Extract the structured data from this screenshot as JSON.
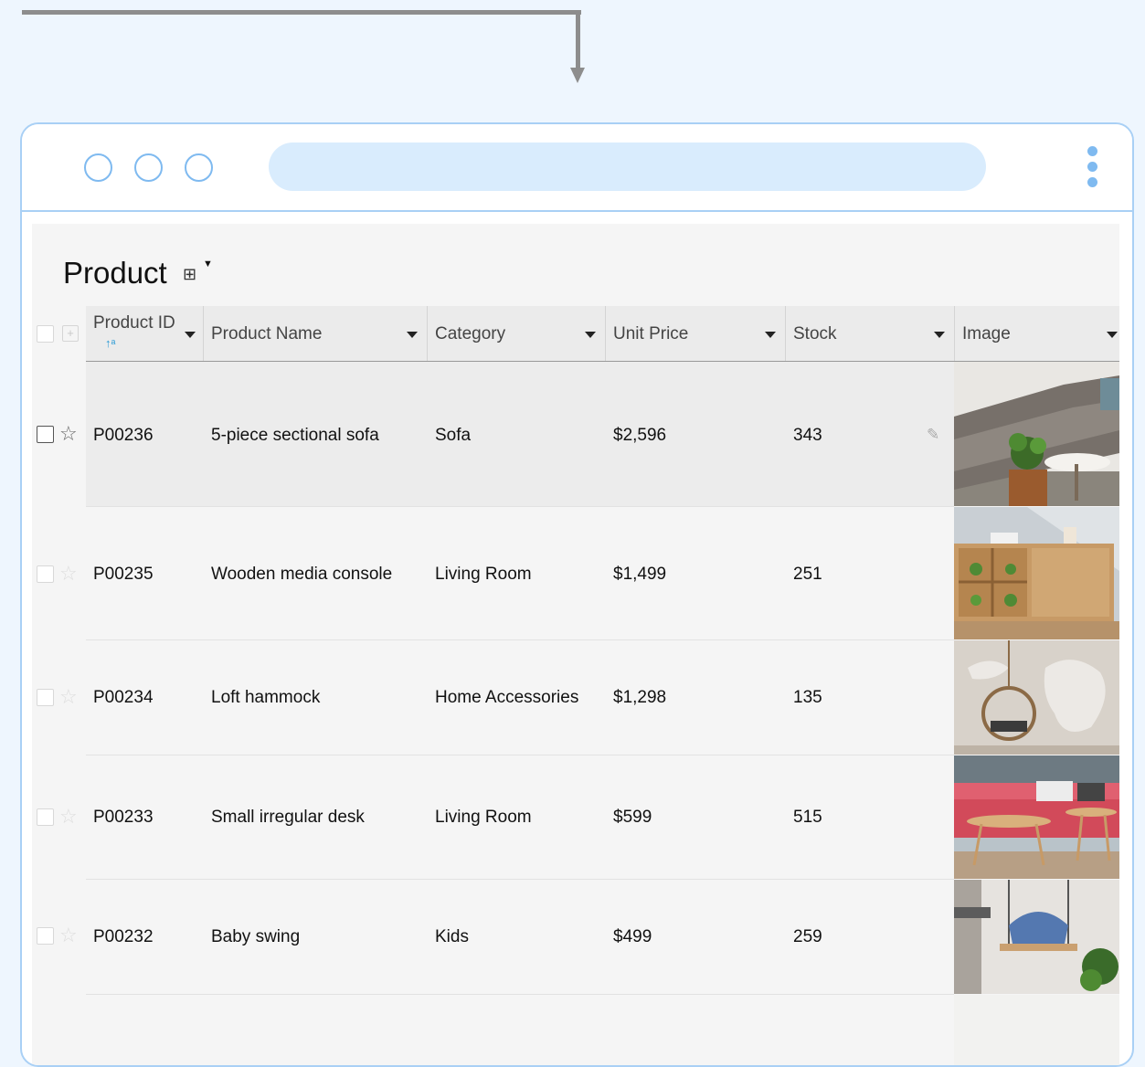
{
  "app": {
    "title": "Product"
  },
  "icons": {
    "view_icon": "table-view-icon",
    "sort": "sort-ascending-icon",
    "edit": "pencil-icon",
    "favorite": "star-icon"
  },
  "table": {
    "columns": [
      {
        "label": "Product ID"
      },
      {
        "label": "Product Name"
      },
      {
        "label": "Category"
      },
      {
        "label": "Unit Price"
      },
      {
        "label": "Stock"
      },
      {
        "label": "Image"
      }
    ],
    "rows": [
      {
        "id": "P00236",
        "name": "5-piece sectional sofa",
        "category": "Sofa",
        "price": "$2,596",
        "stock": "343",
        "image": "gray sectional sofa with plant"
      },
      {
        "id": "P00235",
        "name": "Wooden media console",
        "category": "Living Room",
        "price": "$1,499",
        "stock": "251",
        "image": "wooden media console with plants"
      },
      {
        "id": "P00234",
        "name": "Loft hammock",
        "category": "Home Accessories",
        "price": "$1,298",
        "stock": "135",
        "image": "hanging rattan chair"
      },
      {
        "id": "P00233",
        "name": "Small irregular desk",
        "category": "Living Room",
        "price": "$599",
        "stock": "515",
        "image": "red sofa with wooden coffee tables"
      },
      {
        "id": "P00232",
        "name": "Baby swing",
        "category": "Kids",
        "price": "$499",
        "stock": "259",
        "image": "baby swing with blue patterned seat"
      }
    ]
  },
  "colors": {
    "accent": "#7fbaf0",
    "window_border": "#a9d0f5",
    "address_bar": "#d9ecfd",
    "sort_indicator": "#2a9ad6"
  }
}
